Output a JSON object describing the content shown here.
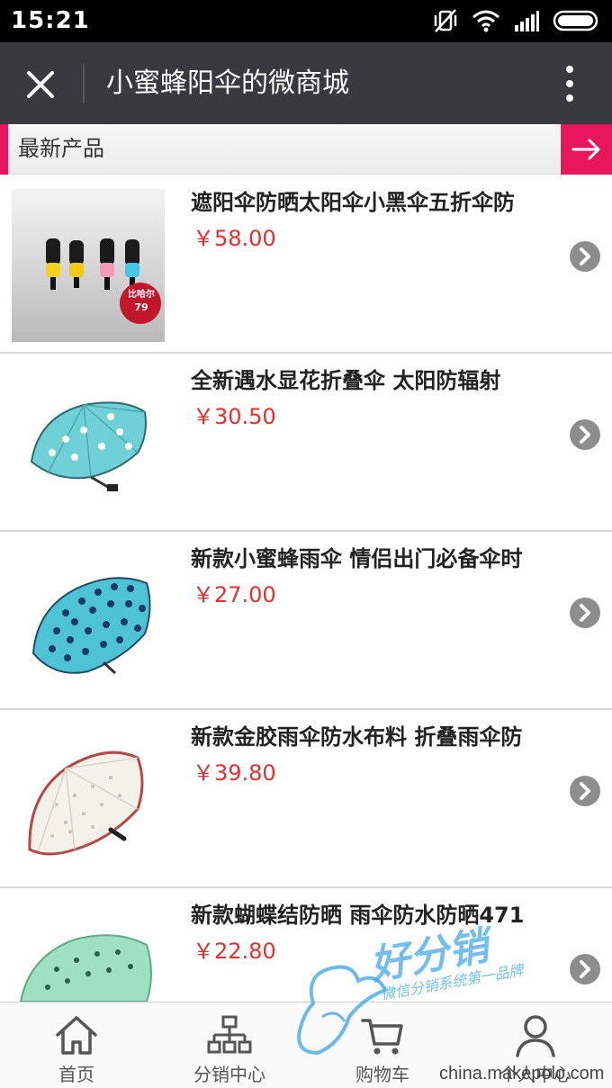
{
  "status_bar": {
    "time": "15:21",
    "icons": [
      "vibrate-off-icon",
      "wifi-icon",
      "signal-icon",
      "battery-icon"
    ]
  },
  "header": {
    "title": "小蜜蜂阳伞的微商城",
    "close_icon": "close-icon",
    "more_icon": "more-vertical-icon"
  },
  "section": {
    "title": "最新产品",
    "accent_color": "#e8175d",
    "arrow_icon": "arrow-right-icon"
  },
  "products": [
    {
      "name": "遮阳伞防晒太阳伞小黑伞五折伞防",
      "price": "￥58.00",
      "badge_text": "比哈尔",
      "badge_price": "79"
    },
    {
      "name": "全新遇水显花折叠伞 太阳防辐射",
      "price": "￥30.50"
    },
    {
      "name": "新款小蜜蜂雨伞 情侣出门必备伞时",
      "price": "￥27.00"
    },
    {
      "name": "新款金胶雨伞防水布料 折叠雨伞防",
      "price": "￥39.80"
    },
    {
      "name": "新款蝴蝶结防晒 雨伞防水防晒471",
      "price": "￥22.80"
    }
  ],
  "bottom_nav": [
    {
      "label": "首页",
      "icon": "home-icon"
    },
    {
      "label": "分销中心",
      "icon": "hierarchy-icon"
    },
    {
      "label": "购物车",
      "icon": "cart-icon"
    },
    {
      "label": "个人中心",
      "icon": "user-icon"
    }
  ],
  "watermark": {
    "brand": "好分销",
    "slogan": "微信分销系统第一品牌",
    "url": "china.makepolo.com"
  },
  "colors": {
    "accent": "#e8175d",
    "price": "#e62e2e",
    "title_bar": "#393a3f"
  }
}
